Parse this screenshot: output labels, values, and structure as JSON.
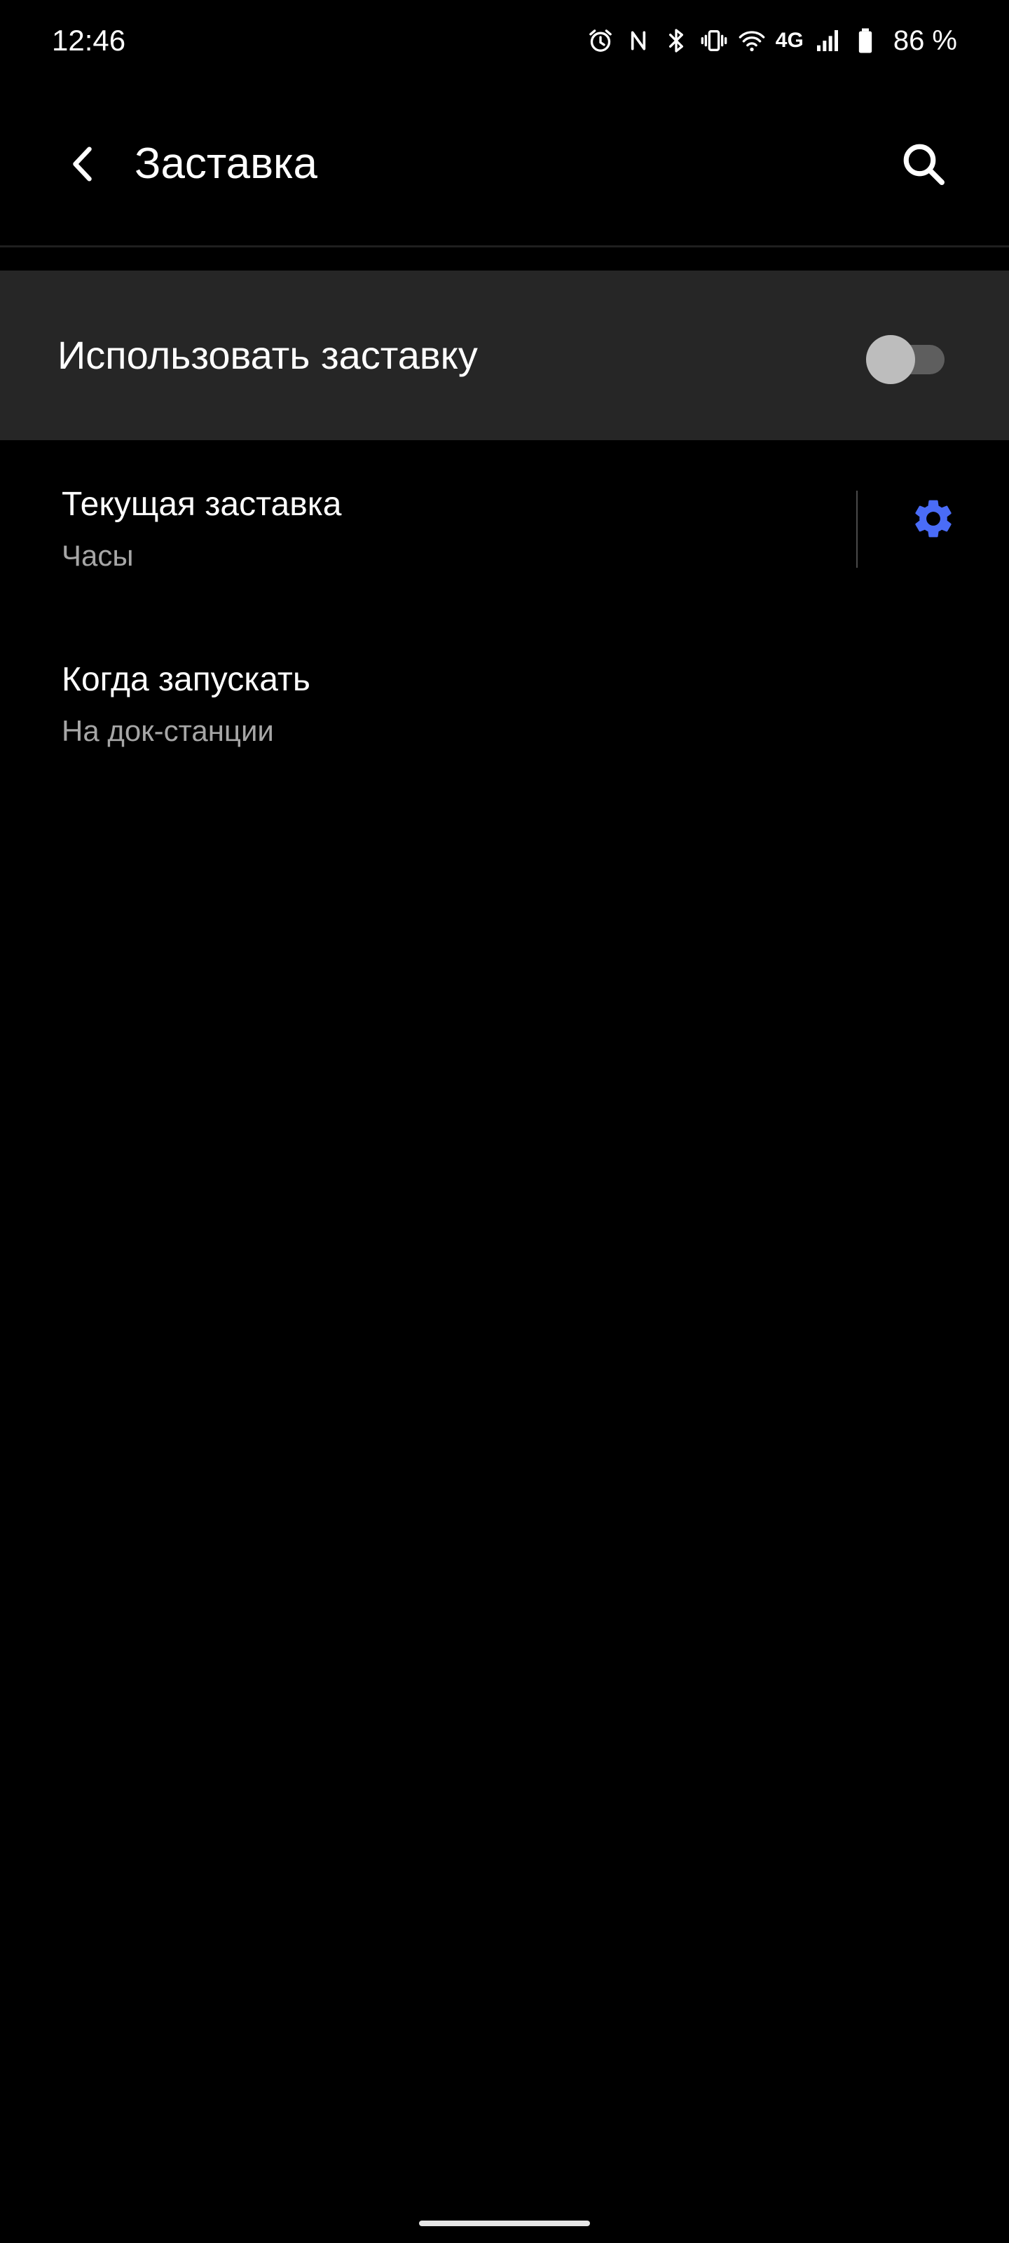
{
  "status_bar": {
    "time": "12:46",
    "icons": [
      "alarm-icon",
      "nfc-icon",
      "bluetooth-icon",
      "vibrate-icon",
      "wifi-icon",
      "signal-icon",
      "battery-icon"
    ],
    "network_label": "4G",
    "battery_percent": "86 %"
  },
  "app_bar": {
    "title": "Заставка",
    "back_icon": "back-arrow-icon",
    "search_icon": "search-icon"
  },
  "master_switch": {
    "label": "Использовать заставку",
    "enabled": false
  },
  "preferences": {
    "current": {
      "title": "Текущая заставка",
      "summary": "Часы",
      "settings_icon": "gear-icon"
    },
    "when": {
      "title": "Когда запускать",
      "summary": "На док-станции"
    }
  },
  "colors": {
    "background": "#000000",
    "master_row_background": "#262626",
    "accent": "#4a6cf7",
    "summary_text": "#a6a6a6",
    "toggle_track_off": "#5e5e5e",
    "toggle_thumb_off": "#bdbdbd"
  }
}
